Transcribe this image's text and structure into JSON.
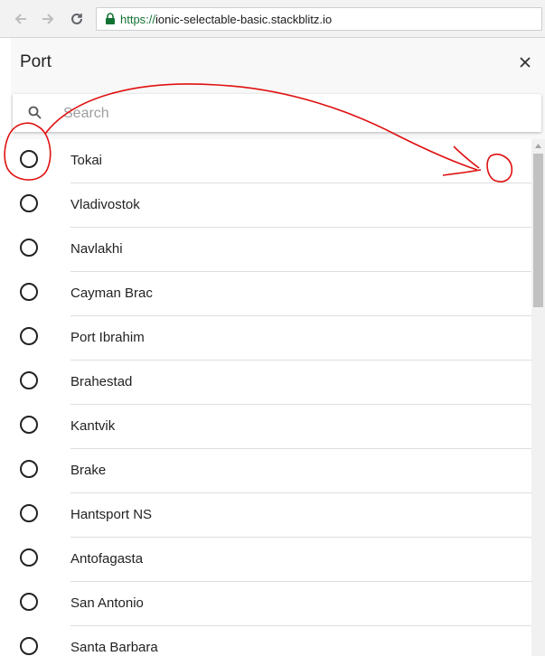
{
  "browser": {
    "url_scheme": "https://",
    "url_host": "ionic-selectable-basic.stackblitz.io",
    "secure_icon": "lock-icon"
  },
  "modal": {
    "title": "Port",
    "close_icon": "close-icon"
  },
  "search": {
    "placeholder": "Search",
    "value": ""
  },
  "items": [
    "Tokai",
    "Vladivostok",
    "Navlakhi",
    "Cayman Brac",
    "Port Ibrahim",
    "Brahestad",
    "Kantvik",
    "Brake",
    "Hantsport NS",
    "Antofagasta",
    "San Antonio",
    "Santa Barbara"
  ],
  "colors": {
    "annotation": "#e01010",
    "secure": "#137333"
  }
}
